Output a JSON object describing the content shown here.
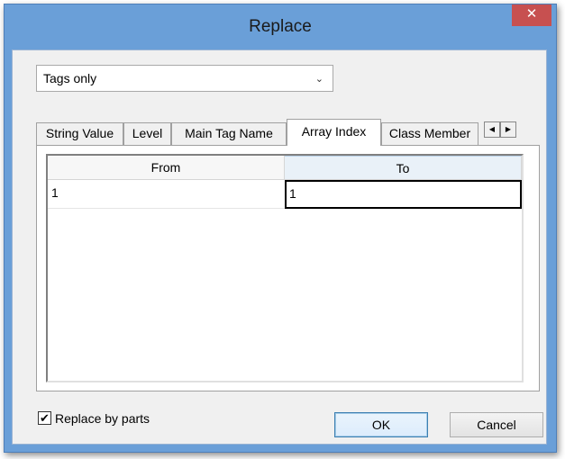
{
  "window": {
    "title": "Replace",
    "close_glyph": "✕"
  },
  "scope_select": {
    "value": "Tags only",
    "arrow_glyph": "⌄"
  },
  "tabs": [
    {
      "label": "String Value"
    },
    {
      "label": "Level"
    },
    {
      "label": "Main Tag Name"
    },
    {
      "label": "Array Index",
      "active": true
    },
    {
      "label": "Class Member"
    }
  ],
  "tab_scroll": {
    "left_glyph": "◀",
    "right_glyph": "▶"
  },
  "grid": {
    "headers": {
      "from": "From",
      "to": "To"
    },
    "rows": [
      {
        "from": "1",
        "to": "1"
      }
    ]
  },
  "replace_by_parts": {
    "label": "Replace by parts",
    "checked": true,
    "check_glyph": "✔"
  },
  "buttons": {
    "ok": "OK",
    "cancel": "Cancel"
  },
  "colors": {
    "titlebar": "#6a9fd8",
    "close": "#c75050",
    "client": "#f0f0f0"
  }
}
